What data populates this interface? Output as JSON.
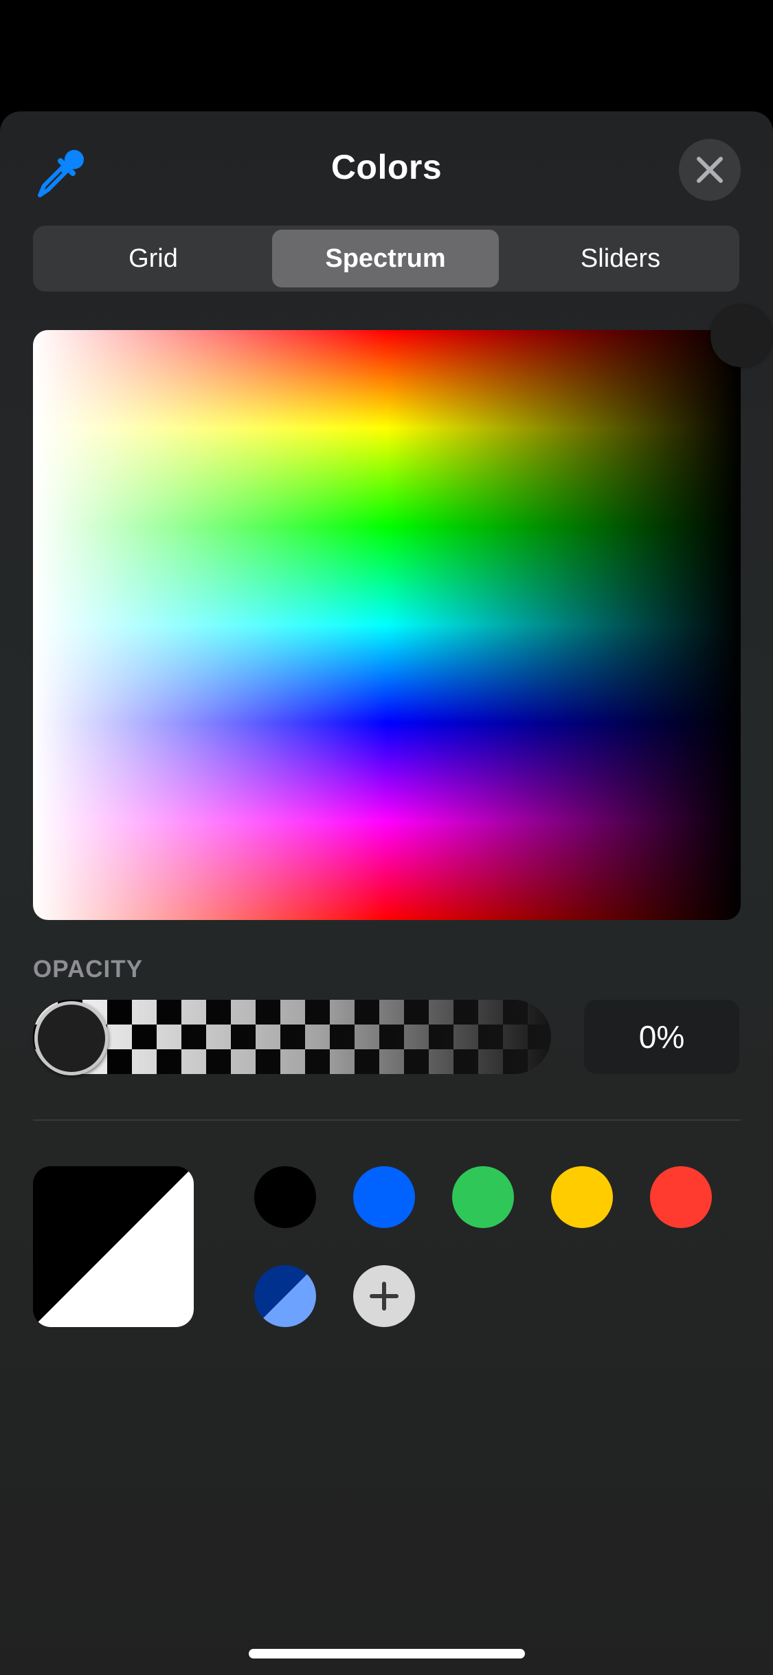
{
  "header": {
    "title": "Colors",
    "eyedropper_icon": "eyedropper-icon",
    "close_icon": "close-icon"
  },
  "tabs": [
    {
      "label": "Grid",
      "selected": false
    },
    {
      "label": "Spectrum",
      "selected": true
    },
    {
      "label": "Sliders",
      "selected": false
    }
  ],
  "opacity": {
    "label": "OPACITY",
    "value_text": "0%",
    "value": 0
  },
  "colors": {
    "accent": "#0a84ff",
    "current_color_split": [
      "#000000",
      "#ffffff"
    ],
    "swatches": [
      {
        "name": "black",
        "color": "#000000"
      },
      {
        "name": "blue",
        "color": "#0062ff"
      },
      {
        "name": "green",
        "color": "#30c759"
      },
      {
        "name": "yellow",
        "color": "#ffcc00"
      },
      {
        "name": "red",
        "color": "#ff3b30"
      },
      {
        "name": "blue-split",
        "color": [
          "#00318f",
          "#6ea2ff"
        ]
      }
    ],
    "add_icon": "plus-icon"
  }
}
